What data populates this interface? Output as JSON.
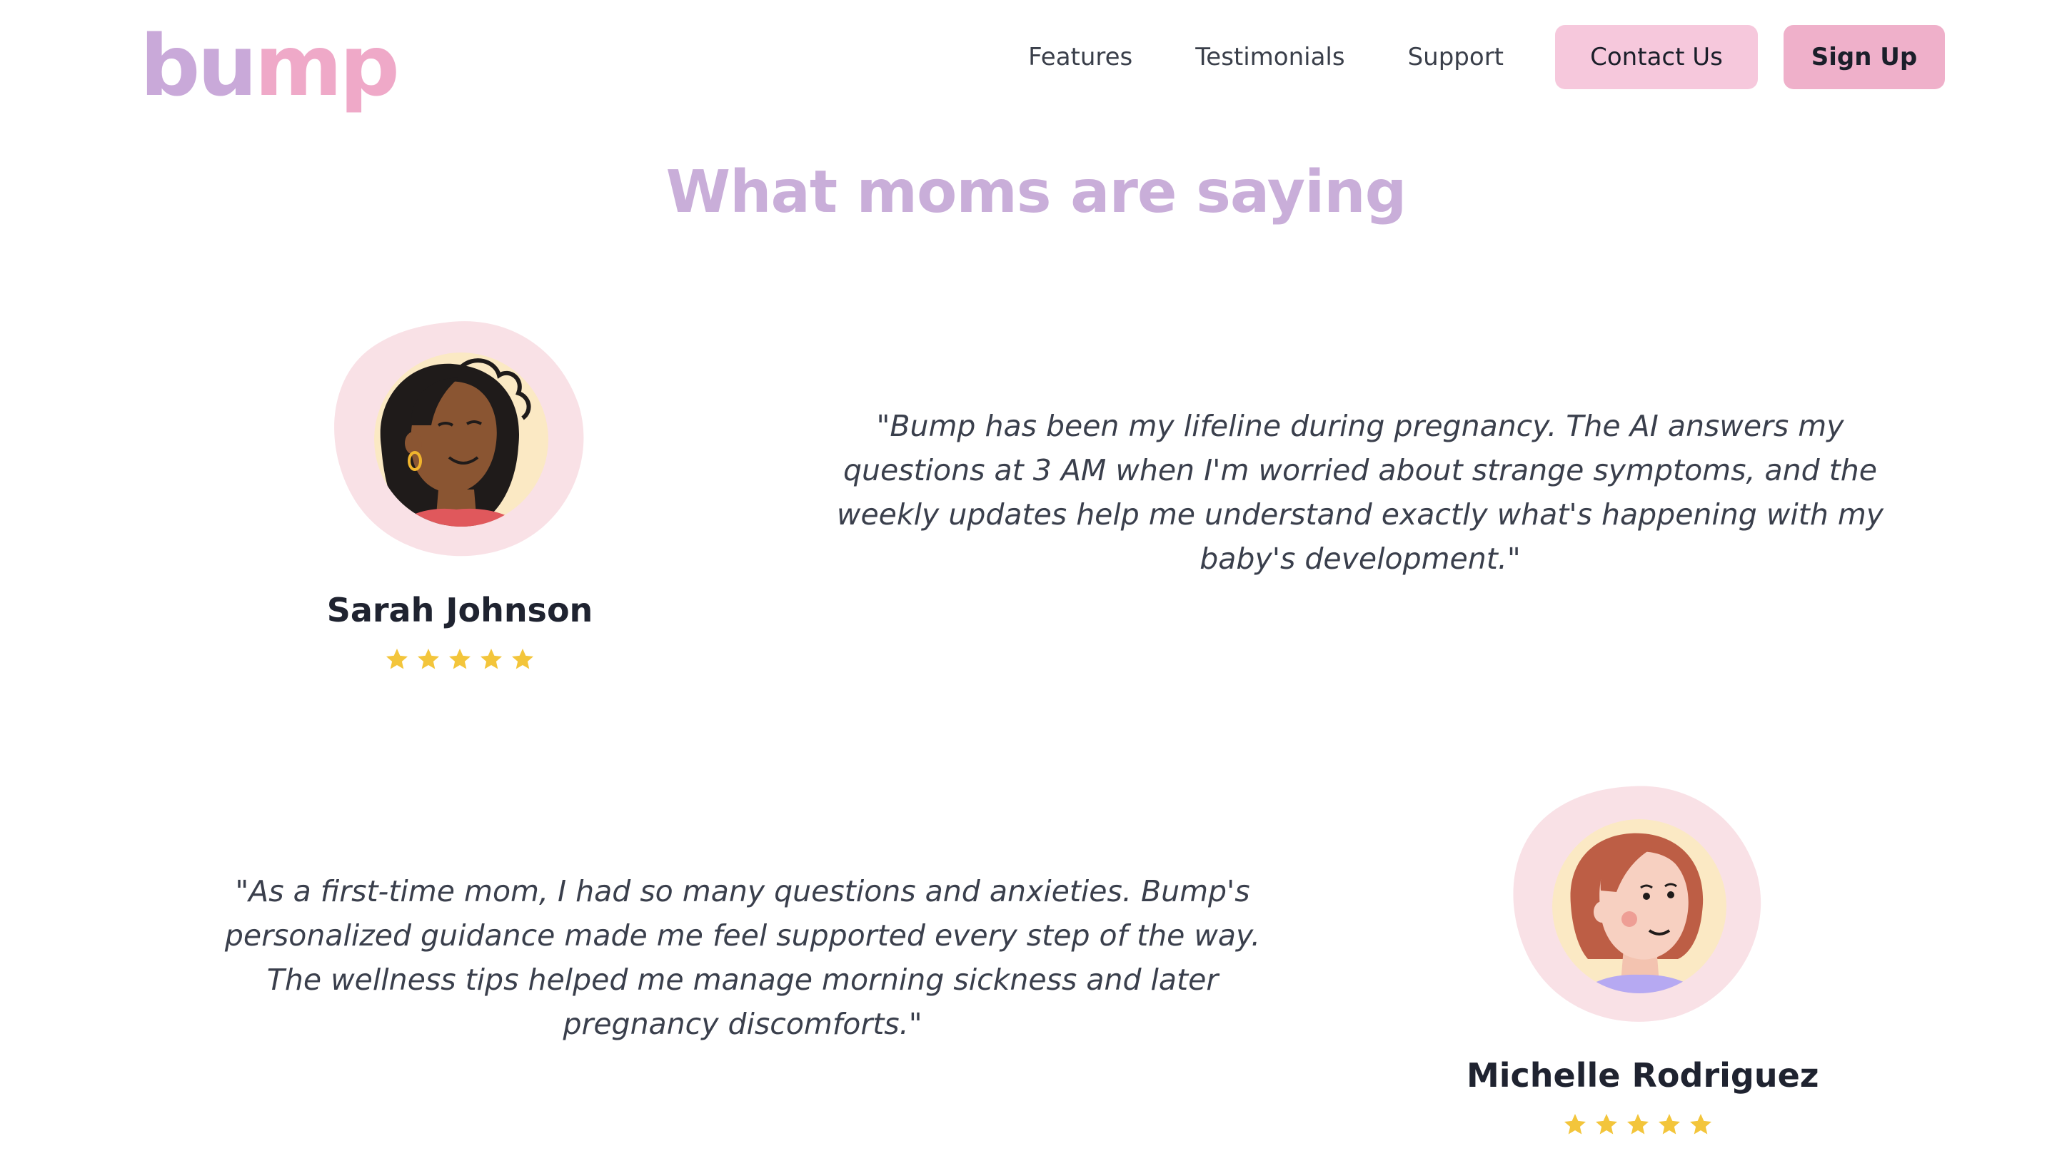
{
  "header": {
    "logo": {
      "part1": "bu",
      "part2": "mp"
    },
    "nav": [
      {
        "label": "Features"
      },
      {
        "label": "Testimonials"
      },
      {
        "label": "Support"
      }
    ],
    "contact_label": "Contact Us",
    "signup_label": "Sign Up"
  },
  "section": {
    "title": "What moms are saying"
  },
  "testimonials": [
    {
      "name": "Sarah Johnson",
      "rating": 5,
      "quote": "\"Bump has been my lifeline during pregnancy. The AI answers my questions at 3 AM when I'm worried about strange symptoms, and the weekly updates help me understand exactly what's happening with my baby's development.\""
    },
    {
      "name": "Michelle Rodriguez",
      "rating": 5,
      "quote": "\"As a first-time mom, I had so many questions and anxieties. Bump's personalized guidance made me feel supported every step of the way. The wellness tips helped me manage morning sickness and later pregnancy discomforts.\""
    }
  ],
  "colors": {
    "brand_purple": "#c9a9d9",
    "brand_pink": "#efa9c8",
    "star": "#f3c53b",
    "blob": "#f9e1e6"
  }
}
